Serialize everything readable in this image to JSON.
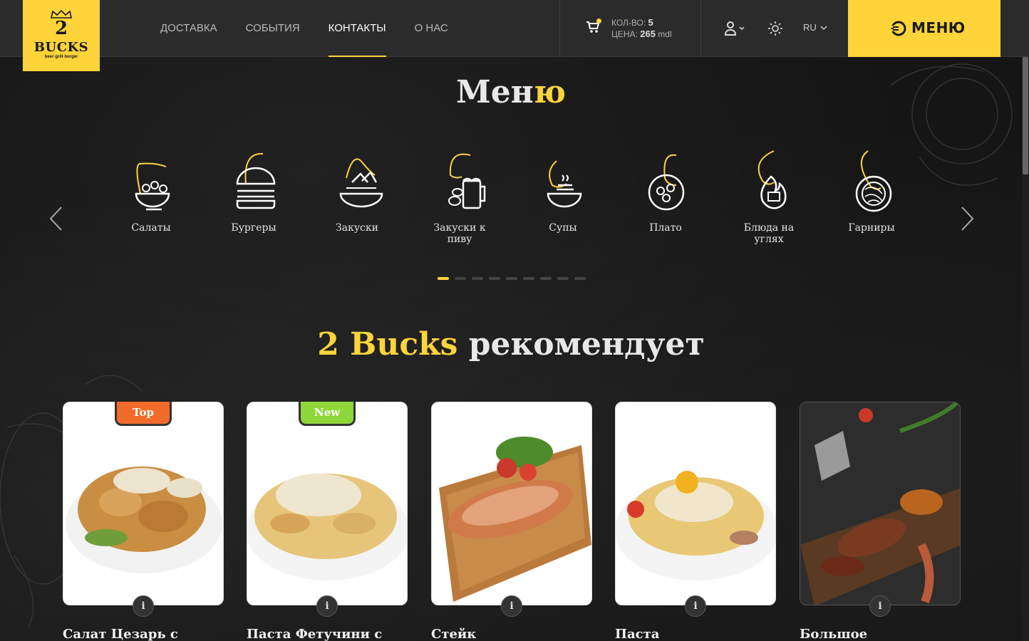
{
  "header": {
    "logo": {
      "number": "2",
      "name": "BUCKS",
      "tagline": "beer·grill·burger"
    },
    "nav": [
      {
        "label": "ДОСТАВКА"
      },
      {
        "label": "СОБЫТИЯ"
      },
      {
        "label": "КОНТАКТЫ",
        "active": true
      },
      {
        "label": "О НАС"
      }
    ],
    "cart": {
      "qty_label": "КОЛ-ВО:",
      "qty_value": "5",
      "price_label": "ЦЕНА:",
      "price_value": "265",
      "currency": "mdl"
    },
    "language": "RU",
    "menu_button_label": "МЕНЮ",
    "accent_color": "#ffd43b"
  },
  "menu_section": {
    "title_main": "Мен",
    "title_highlight": "ю",
    "categories": [
      {
        "label": "Салаты",
        "icon": "salad-bowl-icon"
      },
      {
        "label": "Бургеры",
        "icon": "burger-icon"
      },
      {
        "label": "Закуски",
        "icon": "nachos-icon"
      },
      {
        "label": "Закуски к пиву",
        "icon": "beer-snacks-icon"
      },
      {
        "label": "Супы",
        "icon": "soup-bowl-icon"
      },
      {
        "label": "Плато",
        "icon": "platter-icon"
      },
      {
        "label": "Блюда на углях",
        "icon": "grill-fire-icon"
      },
      {
        "label": "Гарниры",
        "icon": "side-dish-icon"
      }
    ],
    "pagination_count": 9,
    "active_page": 1
  },
  "recommendations": {
    "title_highlight": "2 Bucks",
    "title_main": "рекомендует",
    "items": [
      {
        "name": "Салат Цезарь с",
        "badge": "Top",
        "info": "i"
      },
      {
        "name": "Паста Фетучини с",
        "badge": "New",
        "info": "i"
      },
      {
        "name": "Стейк",
        "badge": "",
        "info": "i"
      },
      {
        "name": "Паста",
        "badge": "",
        "info": "i"
      },
      {
        "name": "Большое",
        "badge": "",
        "info": "i"
      }
    ]
  }
}
